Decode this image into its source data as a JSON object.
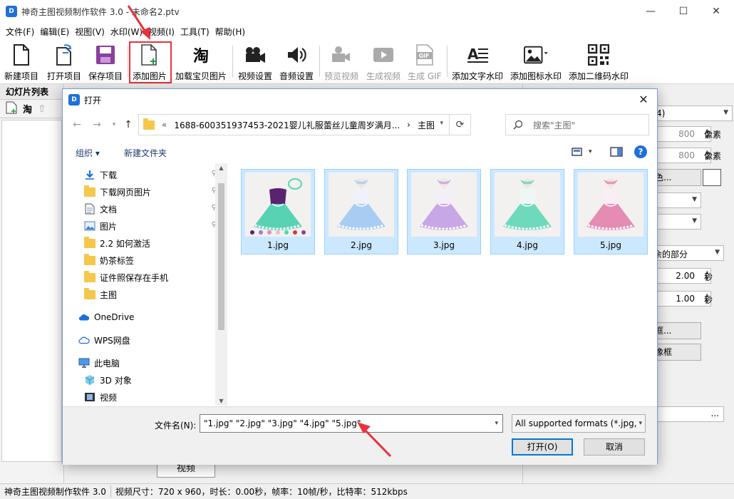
{
  "app": {
    "title": "神奇主图视频制作软件 3.0 - 未命名2.ptv",
    "icon_text": "D"
  },
  "window_controls": {
    "minimize": "—",
    "maximize": "☐",
    "close": "✕"
  },
  "menu": [
    "文件(F)",
    "编辑(E)",
    "视图(V)",
    "水印(W)",
    "视频(I)",
    "工具(T)",
    "帮助(H)"
  ],
  "toolbar": {
    "new_project": "新建项目",
    "open_project": "打开项目",
    "save_project": "保存项目",
    "add_image": "添加图片",
    "load_taobao": "加载宝贝图片",
    "video_settings": "视频设置",
    "audio_settings": "音频设置",
    "preview_video": "预览视频",
    "generate_video": "生成视频",
    "generate_gif": "生成 GIF",
    "add_text_watermark": "添加文字水印",
    "add_icon_watermark": "添加图标水印",
    "add_qr_watermark": "添加二维码水印",
    "gif_badge": "GIF",
    "taobao_glyph": "淘"
  },
  "left_panel": {
    "title": "幻灯片列表",
    "taobao_glyph": "淘"
  },
  "right_panel": {
    "combo1": "4)",
    "width_value": "800",
    "width_unit": "像素",
    "height_value": "800",
    "height_unit": "像素",
    "color_button": "色...",
    "remaining": "余的部分",
    "duration1": "2.00",
    "duration1_unit": "秒",
    "duration2": "1.00",
    "duration2_unit": "秒",
    "frame_button1": "框...",
    "frame_button2": "像框",
    "dots": "..."
  },
  "bottom_tab": "视频",
  "status": {
    "app_name": "神奇主图视频制作软件 3.0",
    "video_info": "视频尺寸：720 x 960，时长：0.00秒，帧率：10帧/秒，比特率：512kbps"
  },
  "dialog": {
    "title": "打开",
    "close": "✕",
    "breadcrumb_prefix": "«",
    "breadcrumb_parent": "1688-600351937453-2021婴儿礼服蕾丝儿童周岁满月...",
    "breadcrumb_sep": "›",
    "breadcrumb_current": "主图",
    "search_placeholder": "搜索\"主图\"",
    "organize": "组织 ▾",
    "new_folder": "新建文件夹",
    "help": "?",
    "nav_items": [
      {
        "label": "下载",
        "icon": "download-arrow-icon",
        "pinned": true
      },
      {
        "label": "下载网页图片",
        "icon": "folder-icon",
        "pinned": true
      },
      {
        "label": "文档",
        "icon": "document-icon",
        "pinned": true
      },
      {
        "label": "图片",
        "icon": "pictures-icon",
        "pinned": true
      },
      {
        "label": "2.2 如何激活",
        "icon": "folder-icon",
        "pinned": false
      },
      {
        "label": "奶茶标签",
        "icon": "folder-icon",
        "pinned": false
      },
      {
        "label": "证件照保存在手机",
        "icon": "folder-icon",
        "pinned": false
      },
      {
        "label": "主图",
        "icon": "folder-icon",
        "pinned": false
      },
      {
        "label": "OneDrive",
        "icon": "onedrive-cloud-icon",
        "pinned": false
      },
      {
        "label": "WPS网盘",
        "icon": "wps-cloud-icon",
        "pinned": false
      },
      {
        "label": "此电脑",
        "icon": "computer-icon",
        "pinned": false
      },
      {
        "label": "3D 对象",
        "icon": "3d-objects-icon",
        "pinned": false
      },
      {
        "label": "视频",
        "icon": "video-icon",
        "pinned": false
      }
    ],
    "files": [
      {
        "name": "1.jpg",
        "color": "#57d3b4",
        "bodice": "#5a2370"
      },
      {
        "name": "2.jpg",
        "color": "#a9cdf2",
        "bodice": "#eef3fa"
      },
      {
        "name": "3.jpg",
        "color": "#c7a7e6",
        "bodice": "#f3eef8"
      },
      {
        "name": "4.jpg",
        "color": "#6ed9bd",
        "bodice": "#eef7f4"
      },
      {
        "name": "5.jpg",
        "color": "#e58cb4",
        "bodice": "#f8eef3"
      }
    ],
    "filename_label": "文件名(N):",
    "filename_value": "\"1.jpg\" \"2.jpg\" \"3.jpg\" \"4.jpg\" \"5.jpg\"",
    "filter_value": "All supported formats (*.jpg,",
    "open_button": "打开(O)",
    "cancel_button": "取消"
  },
  "colors": {
    "accent": "#0078d7",
    "highlight": "#e8323c",
    "selection_bg": "#cce8ff"
  }
}
